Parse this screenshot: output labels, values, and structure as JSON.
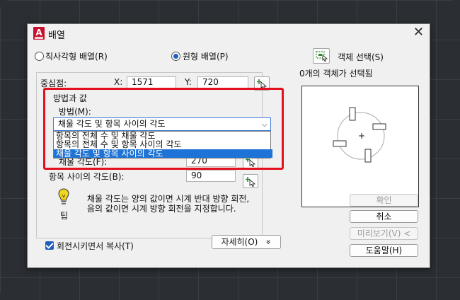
{
  "window": {
    "title": "배열",
    "close_glyph": "✕",
    "app_icon_letter": "A"
  },
  "array_type": {
    "rectangular_label": "직사각형 배열(R)",
    "polar_label": "원형 배열(P)",
    "selected": "polar"
  },
  "select_objects": {
    "label": "객체 선택(S)",
    "status": "0개의 객체가 선택됨"
  },
  "center": {
    "label": "중심점:",
    "x_label": "X:",
    "x_value": "1571",
    "y_label": "Y:",
    "y_value": "720"
  },
  "method_group": {
    "title": "방법과 값",
    "method_label": "방법(M):",
    "selected_option": "채울 각도 및 항목 사이의 각도",
    "options": [
      "항목의 전체 수 및 채울 각도",
      "항목의 전체 수 및 항목 사이의 각도",
      "채울 각도 및 항목 사이의 각도"
    ],
    "fill_angle_label": "채울 각도(F):",
    "fill_angle_value": "270",
    "item_angle_label": "항목 사이의 각도(B):",
    "item_angle_value": "90"
  },
  "tip": {
    "label": "팁",
    "line1": "채울 각도는 양의 값이면 시계 반대 방향 회전,",
    "line2": "음의 값이면 시계 방향 회전을 지정합니다."
  },
  "rotate_copy": {
    "label": "회전시키면서 복사(T)",
    "checked": true
  },
  "buttons": {
    "more": "자세히(O)",
    "more_glyph": "»",
    "ok": "확인",
    "cancel": "취소",
    "preview": "미리보기(V) <",
    "help": "도움말(H)"
  },
  "preview": {
    "center_mark": "+"
  },
  "colors": {
    "accent": "#1e73d6",
    "highlight": "#e3101e",
    "app_icon": "#c8102e"
  }
}
